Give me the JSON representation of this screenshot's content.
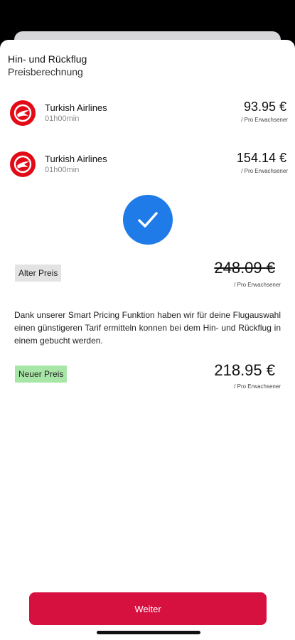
{
  "header": {
    "title": "Hin- und Rückflug",
    "subtitle": "Preisberechnung"
  },
  "flights": [
    {
      "airline": "Turkish Airlines",
      "duration": "01h00min",
      "price": "93.95 €",
      "per": "/ Pro Erwachsener",
      "logo_icon": "turkish-airlines-logo",
      "logo_color": "#e30a17"
    },
    {
      "airline": "Turkish Airlines",
      "duration": "01h00min",
      "price": "154.14 €",
      "per": "/ Pro Erwachsener",
      "logo_icon": "turkish-airlines-logo",
      "logo_color": "#e30a17"
    }
  ],
  "confirmation": {
    "icon": "checkmark-icon",
    "color": "#1e7be8"
  },
  "old_price": {
    "label": "Alter Preis",
    "value": "248.09 €",
    "per": "/ Pro Erwachsener"
  },
  "description": "Dank unserer Smart Pricing Funktion haben wir für deine Flugauswahl einen günstigeren Tarif ermitteln konnen bei dem Hin- und Rückflug in einem gebucht werden.",
  "new_price": {
    "label": "Neuer Preis",
    "value": "218.95 €",
    "per": "/ Pro Erwachsener",
    "label_color": "#a8e6a8"
  },
  "button": {
    "label": "Weiter",
    "color": "#d6103f"
  }
}
